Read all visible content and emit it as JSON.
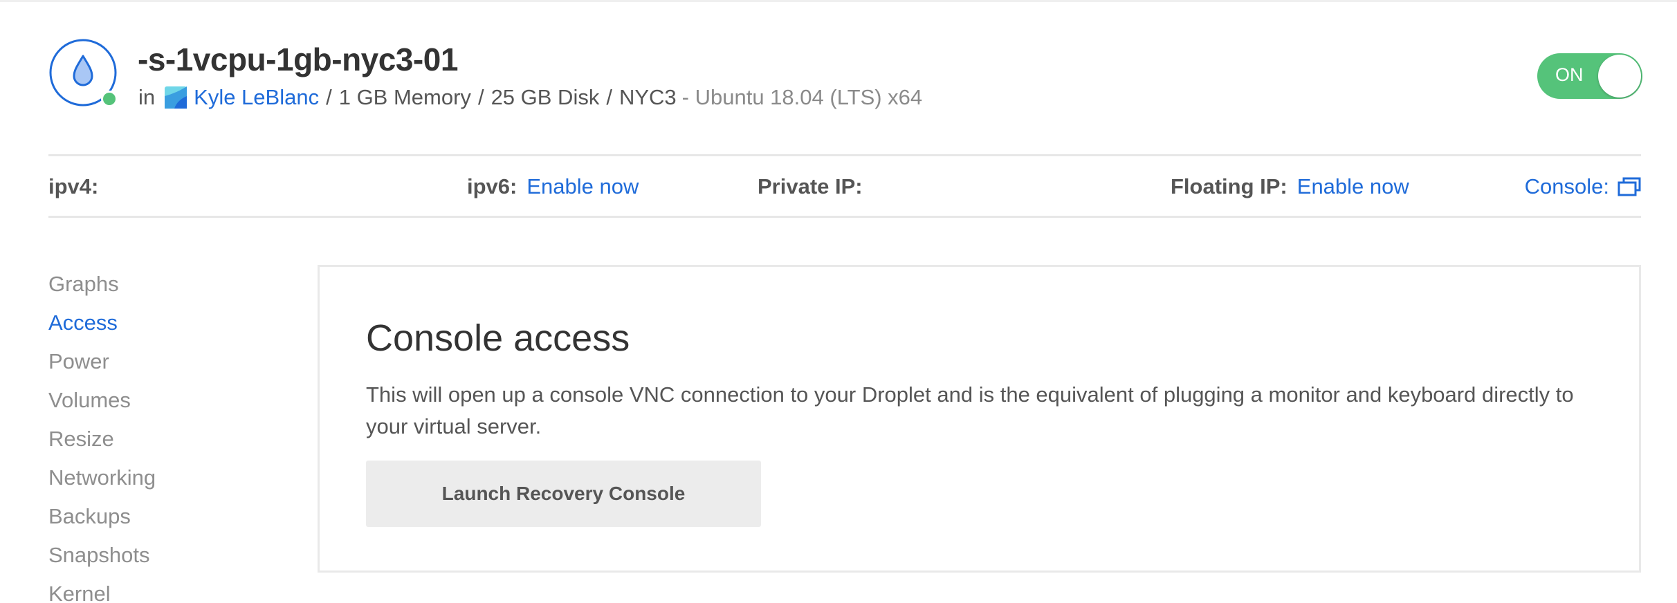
{
  "header": {
    "droplet_name": "-s-1vcpu-1gb-nyc3-01",
    "prefix": "in",
    "team_name": "Kyle LeBlanc",
    "memory": "1 GB Memory",
    "disk": "25 GB Disk",
    "region": "NYC3",
    "os": "- Ubuntu 18.04 (LTS) x64",
    "separator": "/",
    "status_color": "#55c37a"
  },
  "power_toggle": {
    "label": "ON",
    "state": "on",
    "color": "#55c37a"
  },
  "info_bar": {
    "ipv4_label": "ipv4:",
    "ipv6_label": "ipv6:",
    "ipv6_action": "Enable now",
    "private_ip_label": "Private IP:",
    "floating_ip_label": "Floating IP:",
    "floating_ip_action": "Enable now",
    "console_label": "Console:",
    "console_icon": "external-window-icon"
  },
  "sidebar": {
    "items": [
      {
        "label": "Graphs",
        "active": false
      },
      {
        "label": "Access",
        "active": true
      },
      {
        "label": "Power",
        "active": false
      },
      {
        "label": "Volumes",
        "active": false
      },
      {
        "label": "Resize",
        "active": false
      },
      {
        "label": "Networking",
        "active": false
      },
      {
        "label": "Backups",
        "active": false
      },
      {
        "label": "Snapshots",
        "active": false
      },
      {
        "label": "Kernel",
        "active": false
      }
    ]
  },
  "panel": {
    "title": "Console access",
    "description": "This will open up a console VNC connection to your Droplet and is the equivalent of plugging a monitor and keyboard directly to your virtual server.",
    "button_label": "Launch Recovery Console"
  },
  "colors": {
    "accent": "#1f6bd9",
    "success": "#55c37a",
    "muted": "#8e8e8e"
  }
}
